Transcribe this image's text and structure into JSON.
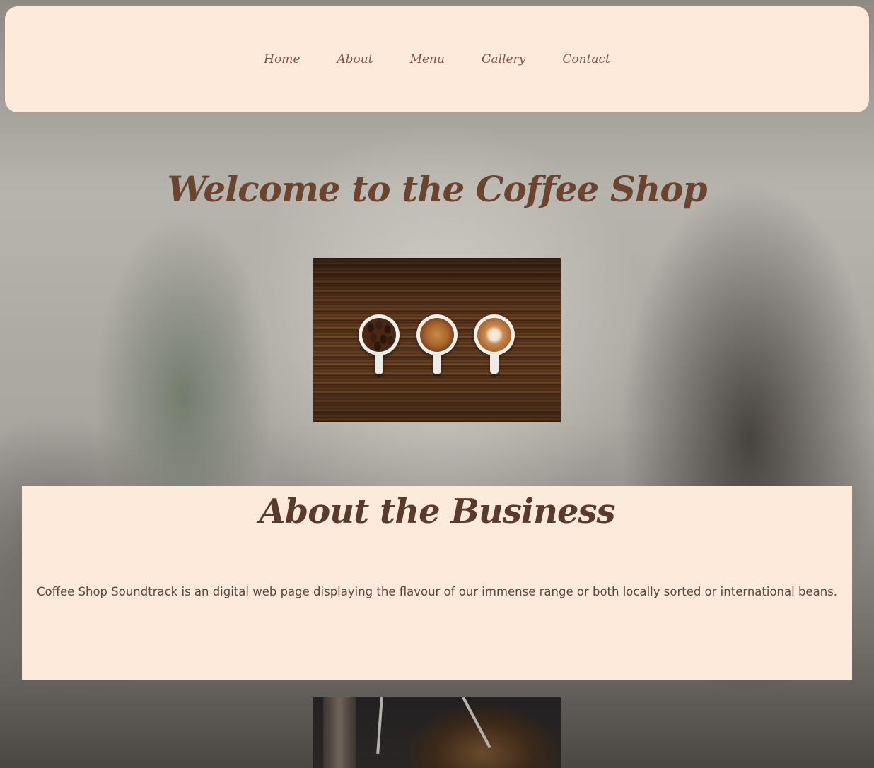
{
  "nav": {
    "links": [
      "Home",
      "About",
      "Menu",
      "Gallery",
      "Contact"
    ]
  },
  "hero": {
    "title": "Welcome to the Coffee Shop",
    "image_alt": "three coffee cups on wooden table"
  },
  "about": {
    "title": "About the Business",
    "text": "Coffee Shop Soundtrack is an digital web page displaying the flavour of our immense range or both locally sorted or international beans."
  },
  "colors": {
    "panel_background": "#fdeadb",
    "heading_brown": "#6b4430",
    "nav_text": "#7a5748"
  }
}
